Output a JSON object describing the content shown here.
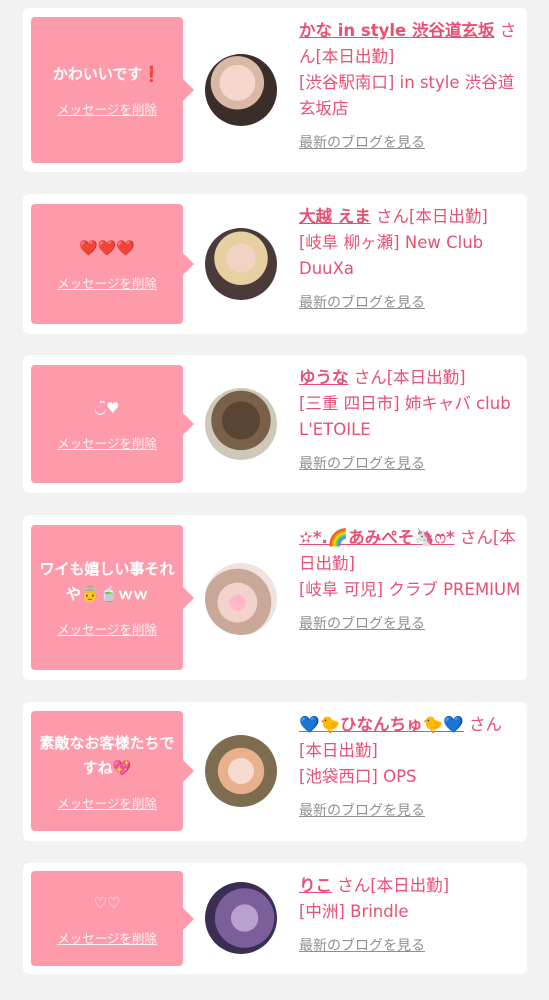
{
  "common": {
    "delete_label": "メッセージを削除",
    "blog_label": "最新のブログを見る",
    "san_label": "さん[本日出勤]"
  },
  "colors": {
    "bubble": "#fe9bab",
    "accent": "#e94f72",
    "link_gray": "#8f8f8f"
  },
  "items": [
    {
      "message": "かわいいです❗",
      "name": "かな in style 渋谷道玄坂",
      "shop": "[渋谷駅南口] in style 渋谷道玄坂店",
      "avatar_icon": "blonde-girl-avatar"
    },
    {
      "message": "❤️❤️❤️",
      "name": "大越 えま",
      "shop": "[岐阜 柳ヶ瀬] New Club DuuXa",
      "avatar_icon": "blonde-girl-avatar"
    },
    {
      "message": "◡̈♥",
      "name": "ゆうな",
      "shop": "[三重 四日市] 姉キャバ club L'ETOILE",
      "avatar_icon": "hair-updo-avatar"
    },
    {
      "message": "ワイも嬉しい事それや👵🍵ｗｗ",
      "name": "✫*.🌈あみぺそ🦄ෆ*",
      "shop": "[岐阜 可児] クラブ PREMIUM",
      "avatar_icon": "girl-heart-avatar"
    },
    {
      "message": "素敵なお客様たちですね💖",
      "name": "💙🐤ひなんちゅ🐤💙",
      "shop": "[池袋西口] OPS",
      "avatar_icon": "girl-sticker-avatar"
    },
    {
      "message": "♡♡",
      "name": "りこ",
      "shop": "[中洲] Brindle",
      "avatar_icon": "purple-blur-avatar"
    }
  ]
}
